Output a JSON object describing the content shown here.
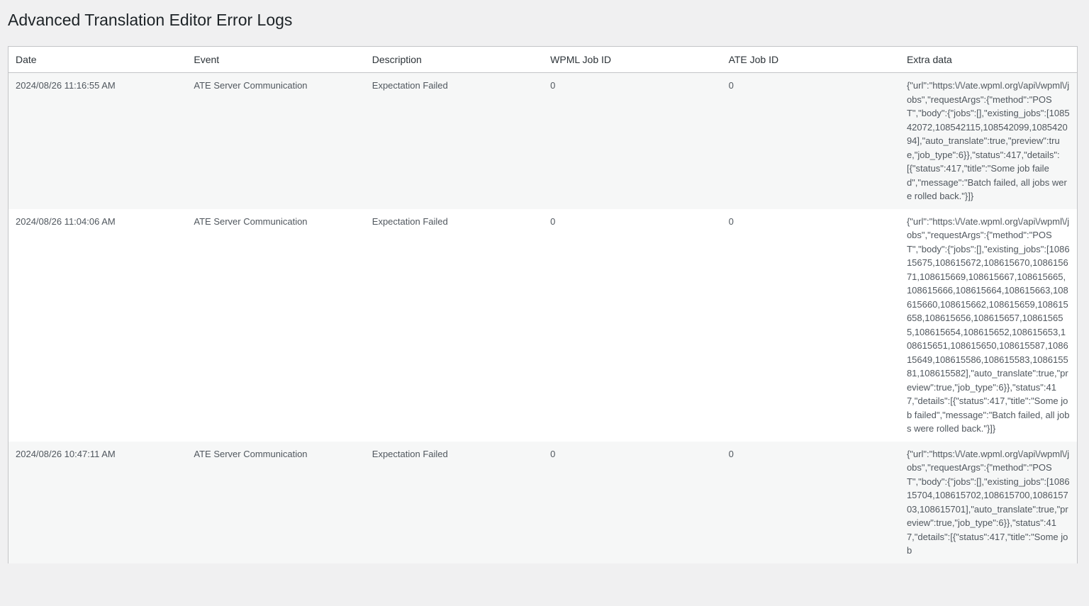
{
  "page": {
    "title": "Advanced Translation Editor Error Logs"
  },
  "table": {
    "headers": {
      "date": "Date",
      "event": "Event",
      "description": "Description",
      "wpml_job_id": "WPML Job ID",
      "ate_job_id": "ATE Job ID",
      "extra_data": "Extra data"
    },
    "rows": [
      {
        "date": "2024/08/26 11:16:55 AM",
        "event": "ATE Server Communication",
        "description": "Expectation Failed",
        "wpml_job_id": "0",
        "ate_job_id": "0",
        "extra_data": "{\"url\":\"https:\\/\\/ate.wpml.org\\/api\\/wpml\\/jobs\",\"requestArgs\":{\"method\":\"POST\",\"body\":{\"jobs\":[],\"existing_jobs\":[108542072,108542115,108542099,108542094],\"auto_translate\":true,\"preview\":true,\"job_type\":6}},\"status\":417,\"details\":[{\"status\":417,\"title\":\"Some job failed\",\"message\":\"Batch failed, all jobs were rolled back.\"}]}"
      },
      {
        "date": "2024/08/26 11:04:06 AM",
        "event": "ATE Server Communication",
        "description": "Expectation Failed",
        "wpml_job_id": "0",
        "ate_job_id": "0",
        "extra_data": "{\"url\":\"https:\\/\\/ate.wpml.org\\/api\\/wpml\\/jobs\",\"requestArgs\":{\"method\":\"POST\",\"body\":{\"jobs\":[],\"existing_jobs\":[108615675,108615672,108615670,108615671,108615669,108615667,108615665,108615666,108615664,108615663,108615660,108615662,108615659,108615658,108615656,108615657,108615655,108615654,108615652,108615653,108615651,108615650,108615587,108615649,108615586,108615583,108615581,108615582],\"auto_translate\":true,\"preview\":true,\"job_type\":6}},\"status\":417,\"details\":[{\"status\":417,\"title\":\"Some job failed\",\"message\":\"Batch failed, all jobs were rolled back.\"}]}"
      },
      {
        "date": "2024/08/26 10:47:11 AM",
        "event": "ATE Server Communication",
        "description": "Expectation Failed",
        "wpml_job_id": "0",
        "ate_job_id": "0",
        "extra_data": "{\"url\":\"https:\\/\\/ate.wpml.org\\/api\\/wpml\\/jobs\",\"requestArgs\":{\"method\":\"POST\",\"body\":{\"jobs\":[],\"existing_jobs\":[108615704,108615702,108615700,108615703,108615701],\"auto_translate\":true,\"preview\":true,\"job_type\":6}},\"status\":417,\"details\":[{\"status\":417,\"title\":\"Some job"
      }
    ]
  }
}
